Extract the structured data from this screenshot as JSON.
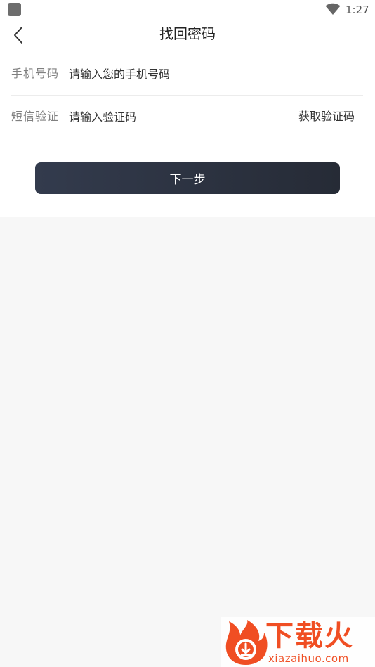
{
  "status_bar": {
    "time": "1:27",
    "icons": [
      "app-notification-icon",
      "wifi-icon"
    ]
  },
  "header": {
    "title": "找回密码",
    "back_icon": "chevron-left-icon"
  },
  "form": {
    "phone": {
      "label": "手机号码",
      "placeholder": "请输入您的手机号码",
      "value": ""
    },
    "code": {
      "label": "短信验证",
      "placeholder": "请输入验证码",
      "value": "",
      "get_code_label": "获取验证码"
    }
  },
  "next_button": {
    "label": "下一步"
  },
  "watermark": {
    "text": "下载火",
    "url": "xiazaihuo.com",
    "brand_color": "#f04e23"
  },
  "colors": {
    "button_bg": "#2c3241",
    "page_bg": "#f7f7f7"
  }
}
